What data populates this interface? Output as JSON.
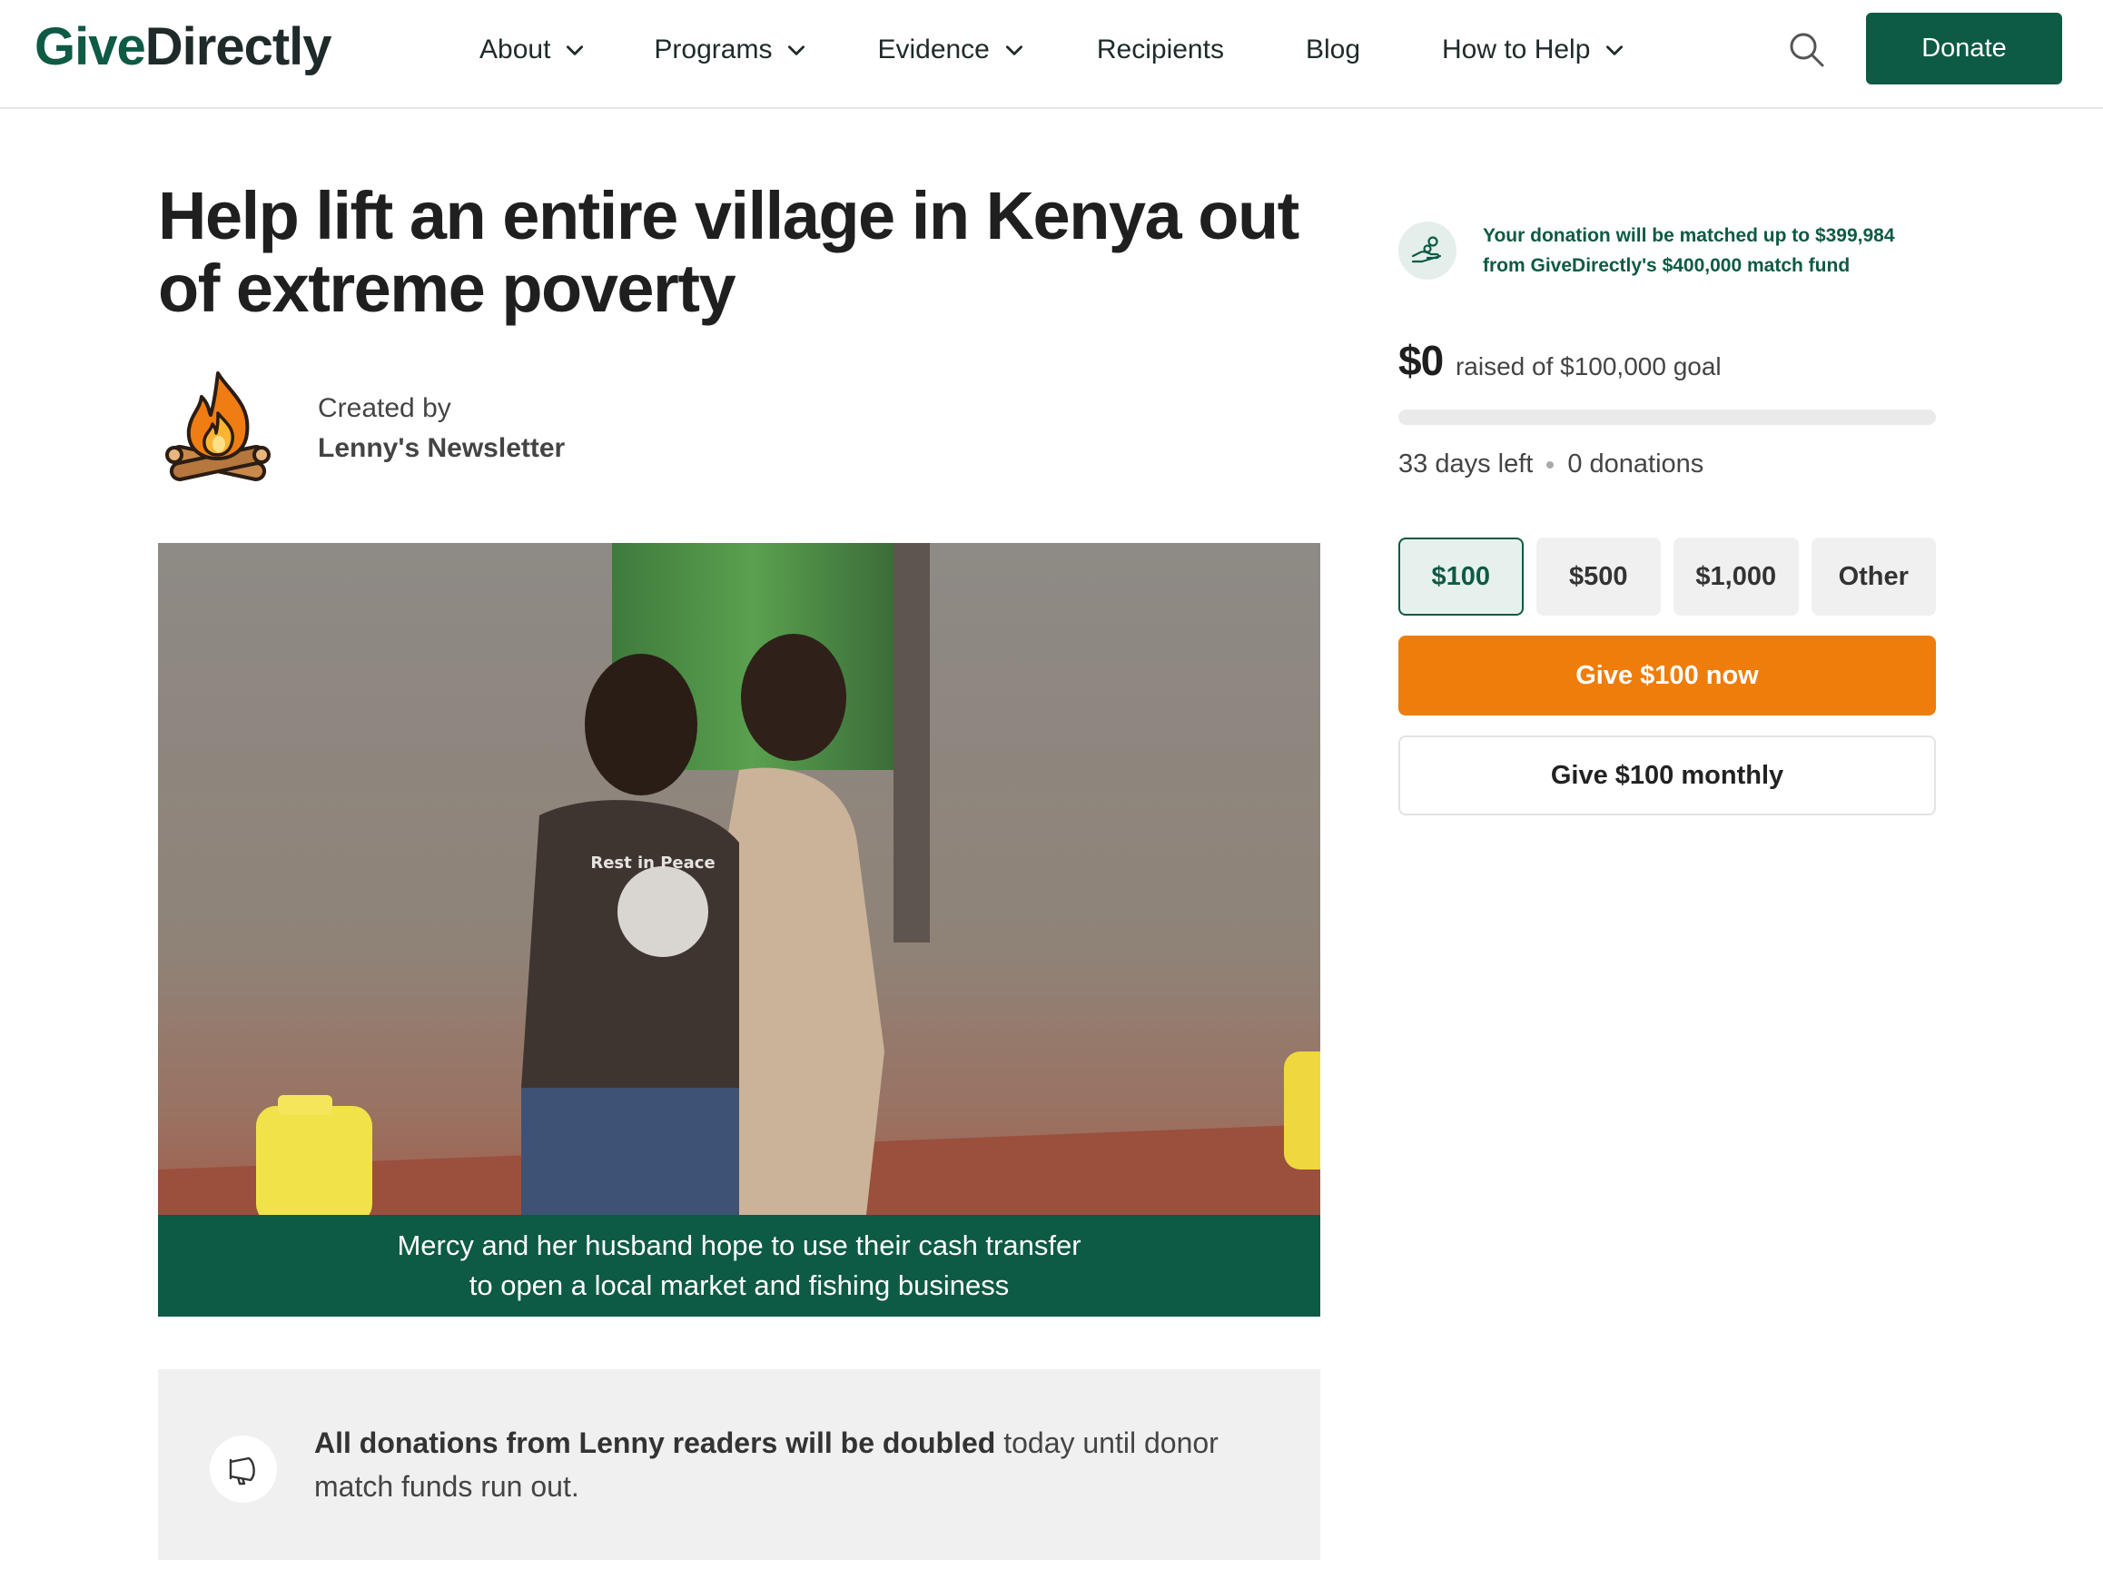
{
  "header": {
    "logo_give": "Give",
    "logo_directly": "Directly",
    "nav": [
      {
        "label": "About",
        "dropdown": true
      },
      {
        "label": "Programs",
        "dropdown": true
      },
      {
        "label": "Evidence",
        "dropdown": true
      },
      {
        "label": "Recipients",
        "dropdown": false
      },
      {
        "label": "Blog",
        "dropdown": false
      },
      {
        "label": "How to Help",
        "dropdown": true
      }
    ],
    "search_icon": "search-icon",
    "donate_label": "Donate"
  },
  "campaign": {
    "title": "Help lift an entire village in Kenya out of extreme poverty",
    "created_by_label": "Created by",
    "creator_name": "Lenny's Newsletter",
    "creator_avatar_icon": "campfire-icon",
    "photo_caption_line1": "Mercy and her husband hope to use their cash transfer",
    "photo_caption_line2": "to open a local market and fishing business",
    "photo_shirt_text": "Rest in Peace",
    "notice_bold": "All donations from Lenny readers will be doubled",
    "notice_rest": " today until donor match funds run out.",
    "notice_icon": "megaphone-icon"
  },
  "sidebar": {
    "match_icon": "hand-coins-icon",
    "match_text": "Your donation will be matched up to $399,984 from GiveDirectly's $400,000 match fund",
    "raised_amount": "$0",
    "raised_label": "raised of $100,000 goal",
    "progress_fraction": 0,
    "days_left": "33 days left",
    "donations_count": "0 donations",
    "amount_options": [
      "$100",
      "$500",
      "$1,000",
      "Other"
    ],
    "selected_amount_index": 0,
    "give_now_label": "Give $100 now",
    "give_monthly_label": "Give $100 monthly"
  },
  "colors": {
    "brand_green": "#0d5a45",
    "cta_orange": "#ee7d0c",
    "light_gray": "#f0f0f0"
  }
}
